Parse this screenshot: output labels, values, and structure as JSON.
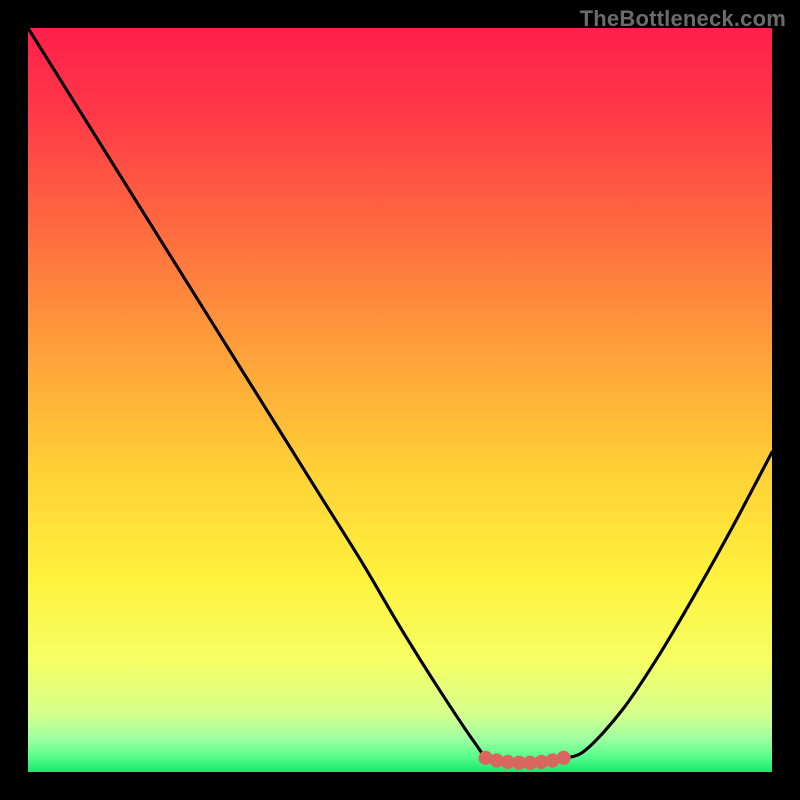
{
  "watermark": "TheBottleneck.com",
  "chart_data": {
    "type": "line",
    "title": "",
    "xlabel": "",
    "ylabel": "",
    "xlim": [
      0,
      100
    ],
    "ylim": [
      0,
      100
    ],
    "grid": false,
    "legend": null,
    "annotations": [],
    "series": [
      {
        "name": "bottleneck-curve",
        "x": [
          0,
          5,
          10,
          15,
          20,
          25,
          30,
          35,
          40,
          45,
          50,
          55,
          60,
          62,
          66,
          70,
          72,
          75,
          80,
          85,
          90,
          95,
          100
        ],
        "values": [
          100,
          92,
          84,
          76,
          68,
          60,
          52,
          44,
          36,
          28,
          19.5,
          11.5,
          4.0,
          1.8,
          1.2,
          1.3,
          1.8,
          3.0,
          8.5,
          16.0,
          24.5,
          33.5,
          43.0
        ]
      },
      {
        "name": "sweet-spot-marker",
        "x": [
          61.5,
          63.0,
          64.5,
          66.0,
          67.5,
          69.0,
          70.5,
          72.0
        ],
        "values": [
          1.9,
          1.55,
          1.35,
          1.25,
          1.25,
          1.35,
          1.55,
          1.9
        ]
      }
    ],
    "background_gradient_stops": [
      {
        "offset": 0.0,
        "color": "#ff1f4b"
      },
      {
        "offset": 0.12,
        "color": "#ff3a48"
      },
      {
        "offset": 0.28,
        "color": "#ff6e3f"
      },
      {
        "offset": 0.44,
        "color": "#ffa23a"
      },
      {
        "offset": 0.6,
        "color": "#ffd236"
      },
      {
        "offset": 0.74,
        "color": "#fff23e"
      },
      {
        "offset": 0.85,
        "color": "#f6ff64"
      },
      {
        "offset": 0.92,
        "color": "#d7ff8c"
      },
      {
        "offset": 0.955,
        "color": "#a0ffa0"
      },
      {
        "offset": 0.978,
        "color": "#5cff8e"
      },
      {
        "offset": 1.0,
        "color": "#17e86b"
      }
    ],
    "marker_style": {
      "color": "#d9675f",
      "radius_pct": 0.95
    }
  }
}
